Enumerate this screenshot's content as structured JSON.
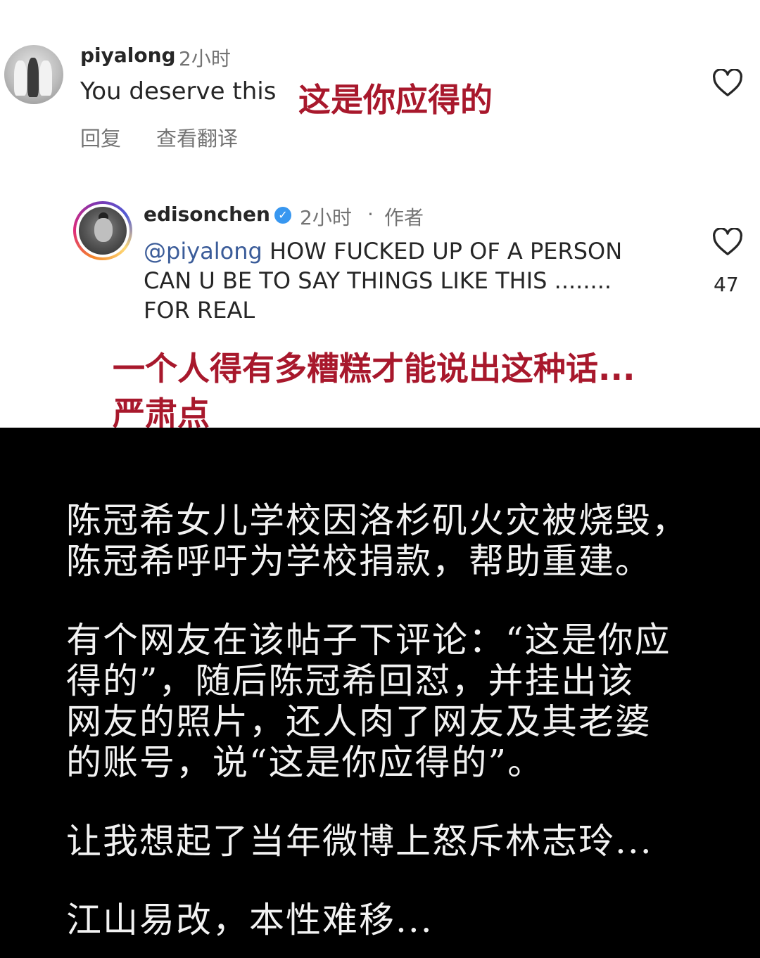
{
  "comment1": {
    "username": "piyalong",
    "time": "2小时",
    "text": "You deserve this",
    "translation_overlay": "这是你应得的",
    "reply_label": "回复",
    "translate_label": "查看翻译"
  },
  "reply": {
    "username": "edisonchen",
    "time": "2小时",
    "separator": "·",
    "author_tag": "作者",
    "mention": "@piyalong",
    "text_line1": " HOW FUCKED UP OF A PERSON",
    "text_line2": "CAN U BE TO SAY THINGS LIKE THIS ........",
    "text_line3": "FOR REAL",
    "likes": "47",
    "translation_line1": "一个人得有多糟糕才能说出这种话...",
    "translation_line2": "严肃点"
  },
  "caption": {
    "p1_line1": "陈冠希女儿学校因洛杉矶火灾被烧毁，",
    "p1_line2": "陈冠希呼吁为学校捐款，帮助重建。",
    "p2_line1": "有个网友在该帖子下评论：“这是你应",
    "p2_line2": "得的”，随后陈冠希回怼，并挂出该",
    "p2_line3": "网友的照片，还人肉了网友及其老婆",
    "p2_line4": "的账号，说“这是你应得的”。",
    "p3": "让我想起了当年微博上怒斥林志玲...",
    "p4": "江山易改，本性难移..."
  },
  "icons": {
    "heart": "heart-outline-icon",
    "verified": "verified-badge-icon"
  },
  "colors": {
    "overlay_red": "#a8182c",
    "verified_blue": "#3897f0",
    "caption_bg": "#000000"
  }
}
